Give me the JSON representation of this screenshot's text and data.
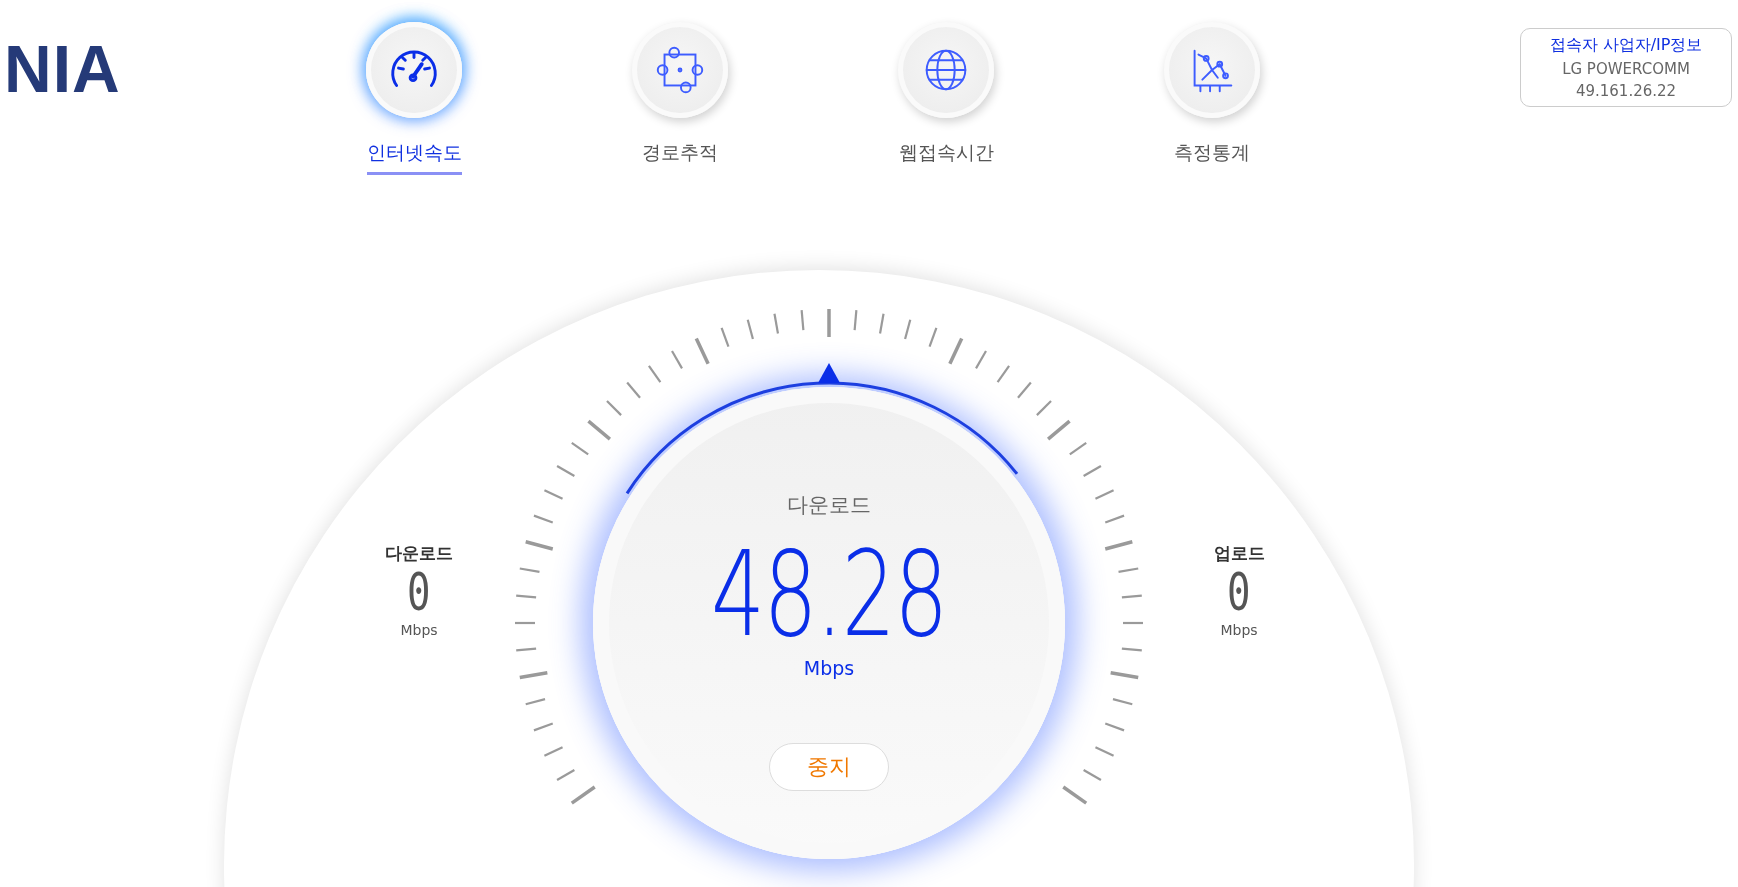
{
  "logo": "NIA",
  "tabs": [
    {
      "label": "인터넷속도",
      "kind": "gauge",
      "selected": true
    },
    {
      "label": "경로추적",
      "kind": "route",
      "selected": false
    },
    {
      "label": "웹접속시간",
      "kind": "globe",
      "selected": false
    },
    {
      "label": "측정통계",
      "kind": "stats",
      "selected": false
    }
  ],
  "provider": {
    "title": "접속자 사업자/IP정보",
    "name": "LG POWERCOMM",
    "ip": "49.161.26.22"
  },
  "readouts": [
    {
      "label": "다운로드",
      "value": "0",
      "unit": "Mbps"
    },
    {
      "label": "업로드",
      "value": "0",
      "unit": "Mbps"
    }
  ],
  "gauge": {
    "phase": "다운로드",
    "value": "48.28",
    "unit": "Mbps",
    "level": 0.5,
    "button": "중지"
  }
}
